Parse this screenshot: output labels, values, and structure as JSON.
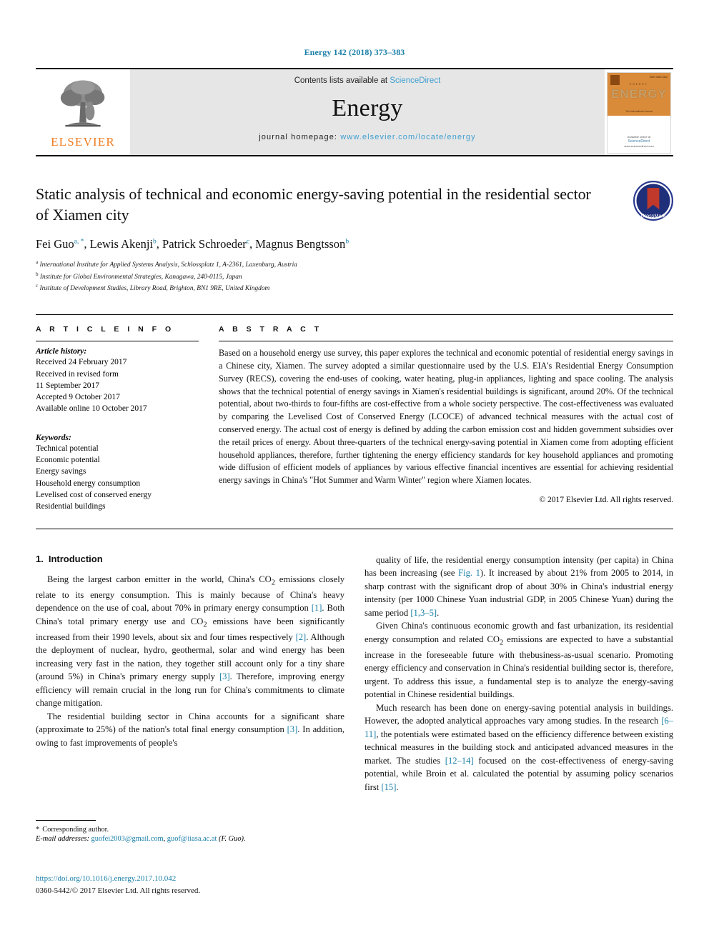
{
  "running_head": "Energy 142 (2018) 373–383",
  "masthead": {
    "contents_prefix": "Contents lists available at ",
    "sciencedirect": "ScienceDirect",
    "journal_name": "Energy",
    "homepage_prefix": "journal homepage: ",
    "homepage_url": "www.elsevier.com/locate/energy",
    "publisher_wordmark": "ELSEVIER",
    "cover": {
      "kicker": "ENERGY",
      "title": "ENERGY",
      "issue": "ISSN 0360-5442",
      "tagline": "The International Journal",
      "footer_line1": "Available online at",
      "footer_line2": "ScienceDirect",
      "footer_line3": "www.sciencedirect.com"
    },
    "accent_color": "#3f9fd0",
    "elsevier_orange": "#ef7d22"
  },
  "title_block": {
    "title": "Static analysis of technical and economic energy-saving potential in the residential sector of Xiamen city",
    "crossmark_label": "CrossMark",
    "authors": [
      {
        "name": "Fei Guo",
        "marks": "a, *"
      },
      {
        "name": "Lewis Akenji",
        "marks": "b"
      },
      {
        "name": "Patrick Schroeder",
        "marks": "c"
      },
      {
        "name": "Magnus Bengtsson",
        "marks": "b"
      }
    ],
    "affiliations": [
      {
        "mark": "a",
        "text": "International Institute for Applied Systems Analysis, Schlossplatz 1, A-2361, Laxenburg, Austria"
      },
      {
        "mark": "b",
        "text": "Institute for Global Environmental Strategies, Kanagawa, 240-0115, Japan"
      },
      {
        "mark": "c",
        "text": "Institute of Development Studies, Library Road, Brighton, BN1 9RE, United Kingdom"
      }
    ]
  },
  "article_info": {
    "section_label": "A R T I C L E  I N F O",
    "history_heading": "Article history:",
    "history": [
      "Received 24 February 2017",
      "Received in revised form",
      "11 September 2017",
      "Accepted 9 October 2017",
      "Available online 10 October 2017"
    ],
    "keywords_heading": "Keywords:",
    "keywords": [
      "Technical potential",
      "Economic potential",
      "Energy savings",
      "Household energy consumption",
      "Levelised cost of conserved energy",
      "Residential buildings"
    ]
  },
  "abstract": {
    "section_label": "A B S T R A C T",
    "text": "Based on a household energy use survey, this paper explores the technical and economic potential of residential energy savings in a Chinese city, Xiamen. The survey adopted a similar questionnaire used by the U.S. EIA's Residential Energy Consumption Survey (RECS), covering the end-uses of cooking, water heating, plug-in appliances, lighting and space cooling. The analysis shows that the technical potential of energy savings in Xiamen's residential buildings is significant, around 20%. Of the technical potential, about two-thirds to four-fifths are cost-effective from a whole society perspective. The cost-effectiveness was evaluated by comparing the Levelised Cost of Conserved Energy (LCOCE) of advanced technical measures with the actual cost of conserved energy. The actual cost of energy is defined by adding the carbon emission cost and hidden government subsidies over the retail prices of energy. About three-quarters of the technical energy-saving potential in Xiamen come from adopting efficient household appliances, therefore, further tightening the energy efficiency standards for key household appliances and promoting wide diffusion of efficient models of appliances by various effective financial incentives are essential for achieving residential energy savings in China's \"Hot Summer and Warm Winter\" region where Xiamen locates.",
    "copyright": "© 2017 Elsevier Ltd. All rights reserved."
  },
  "body": {
    "section_number": "1.",
    "section_title": "Introduction",
    "left_column": [
      "Being the largest carbon emitter in the world, China's CO2 emissions closely relate to its energy consumption. This is mainly because of China's heavy dependence on the use of coal, about 70% in primary energy consumption [1]. Both China's total primary energy use and CO2 emissions have been significantly increased from their 1990 levels, about six and four times respectively [2]. Although the deployment of nuclear, hydro, geothermal, solar and wind energy has been increasing very fast in the nation, they together still account only for a tiny share (around 5%) in China's primary energy supply [3]. Therefore, improving energy efficiency will remain crucial in the long run for China's commitments to climate change mitigation.",
      "The residential building sector in China accounts for a significant share (approximate to 25%) of the nation's total final energy consumption [3]. In addition, owing to fast improvements of people's"
    ],
    "right_column": [
      "quality of life, the residential energy consumption intensity (per capita) in China has been increasing (see Fig. 1). It increased by about 21% from 2005 to 2014, in sharp contrast with the significant drop of about 30% in China's industrial energy intensity (per 1000 Chinese Yuan industrial GDP, in 2005 Chinese Yuan) during the same period [1,3–5].",
      "Given China's continuous economic growth and fast urbanization, its residential energy consumption and related CO2 emissions are expected to have a substantial increase in the foreseeable future with thebusiness-as-usual scenario. Promoting energy efficiency and conservation in China's residential building sector is, therefore, urgent. To address this issue, a fundamental step is to analyze the energy-saving potential in Chinese residential buildings.",
      "Much research has been done on energy-saving potential analysis in buildings. However, the adopted analytical approaches vary among studies. In the research [6–11], the potentials were estimated based on the efficiency difference between existing technical measures in the building stock and anticipated advanced measures in the market. The studies [12–14] focused on the cost-effectiveness of energy-saving potential, while Broin et al. calculated the potential by assuming policy scenarios first [15]."
    ]
  },
  "footnotes": {
    "corresponding_star": "*",
    "corresponding_label": "Corresponding author.",
    "email_label": "E-mail addresses:",
    "email_1": "guofei2003@gmail.com",
    "email_2": "guof@iiasa.ac.at",
    "email_suffix": "(F. Guo)."
  },
  "bottom": {
    "doi": "https://doi.org/10.1016/j.energy.2017.10.042",
    "issn": "0360-5442/© 2017 Elsevier Ltd. All rights reserved."
  }
}
